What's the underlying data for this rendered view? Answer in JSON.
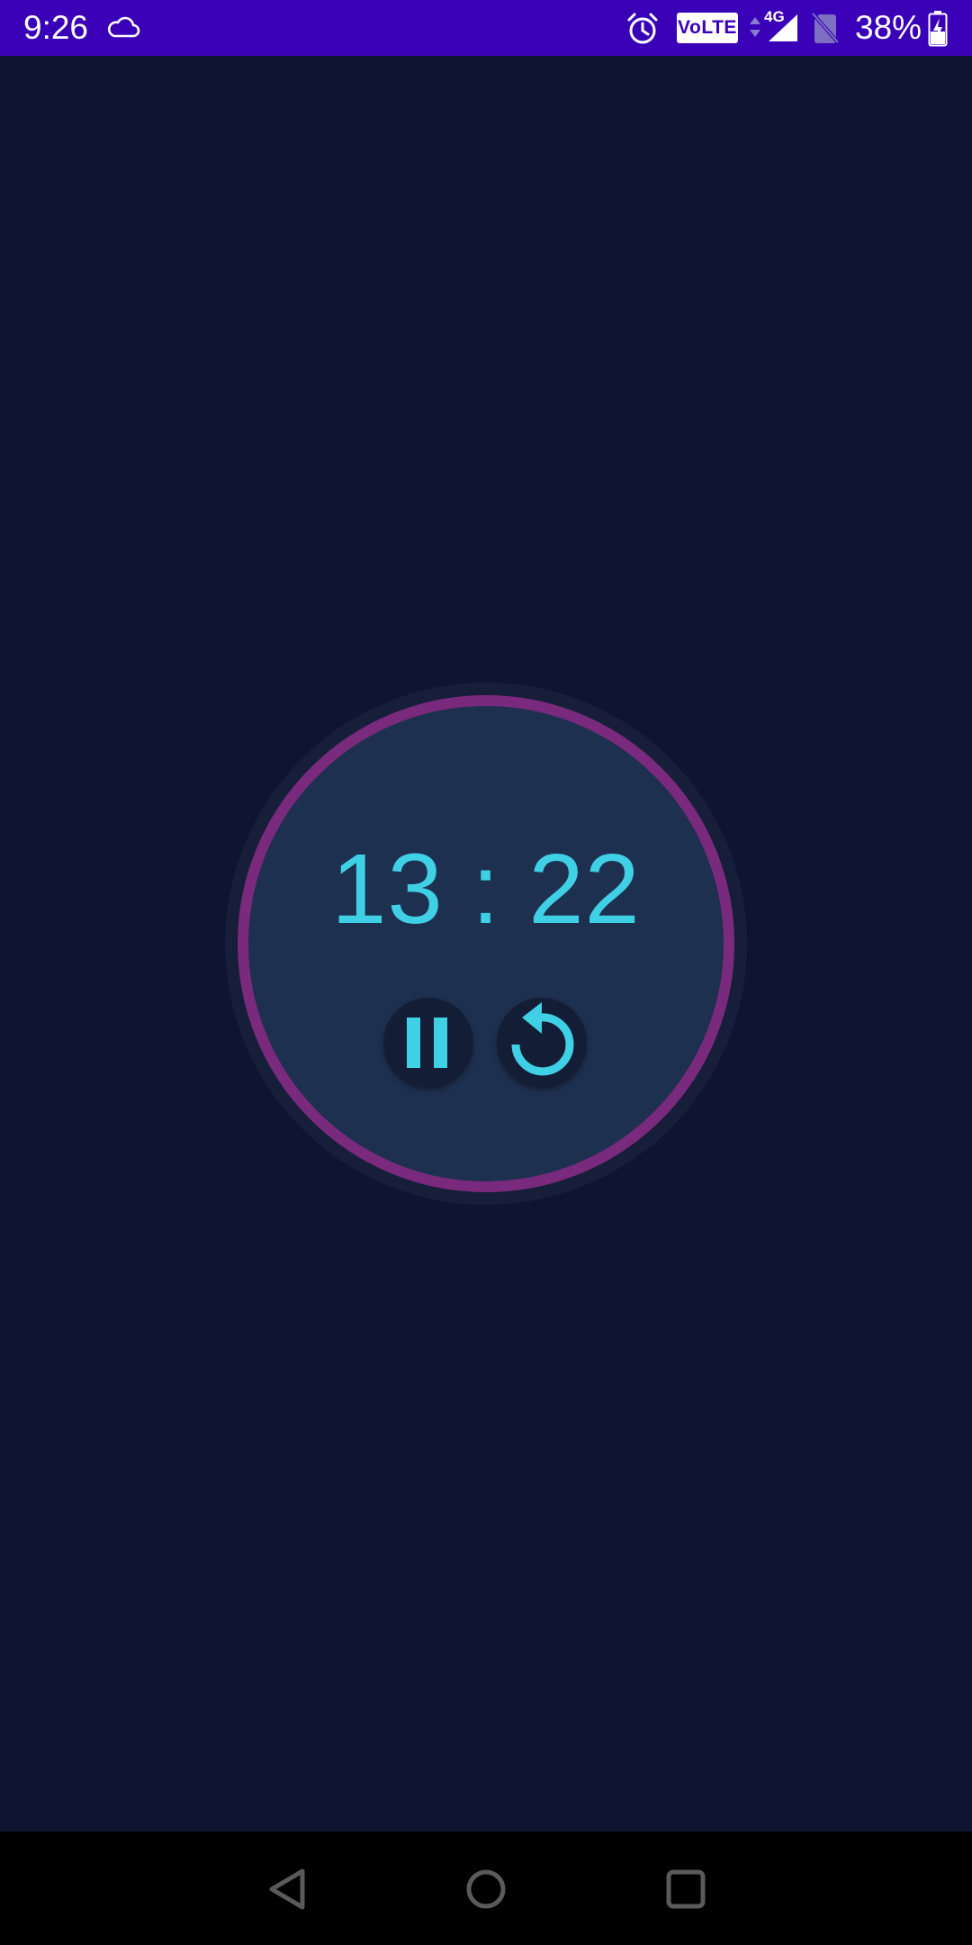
{
  "status_bar": {
    "time": "9:26",
    "volte_label": "VoLTE",
    "network_type": "4G",
    "battery_percent": "38%",
    "battery_level": 0.38,
    "background_color": "#3a00b8",
    "icons": [
      "cloud-icon",
      "alarm-icon",
      "volte-icon",
      "data-arrows-icon",
      "signal-icon",
      "no-sim-icon",
      "battery-charging-icon"
    ]
  },
  "timer": {
    "minutes": "13",
    "separator": ":",
    "seconds": "22",
    "display": "13 : 22",
    "ring_color": "#7a2a7c",
    "text_color": "#3fd0e6",
    "face_color": "#1e3050",
    "controls": [
      {
        "name": "pause-button",
        "icon": "pause-icon"
      },
      {
        "name": "reset-button",
        "icon": "reset-icon"
      }
    ]
  },
  "nav_bar": {
    "buttons": [
      {
        "name": "back-button",
        "icon": "back-triangle-icon"
      },
      {
        "name": "home-button",
        "icon": "home-circle-icon"
      },
      {
        "name": "recents-button",
        "icon": "recents-square-icon"
      }
    ]
  },
  "colors": {
    "background": "#0f1530",
    "accent": "#3fd0e6"
  }
}
